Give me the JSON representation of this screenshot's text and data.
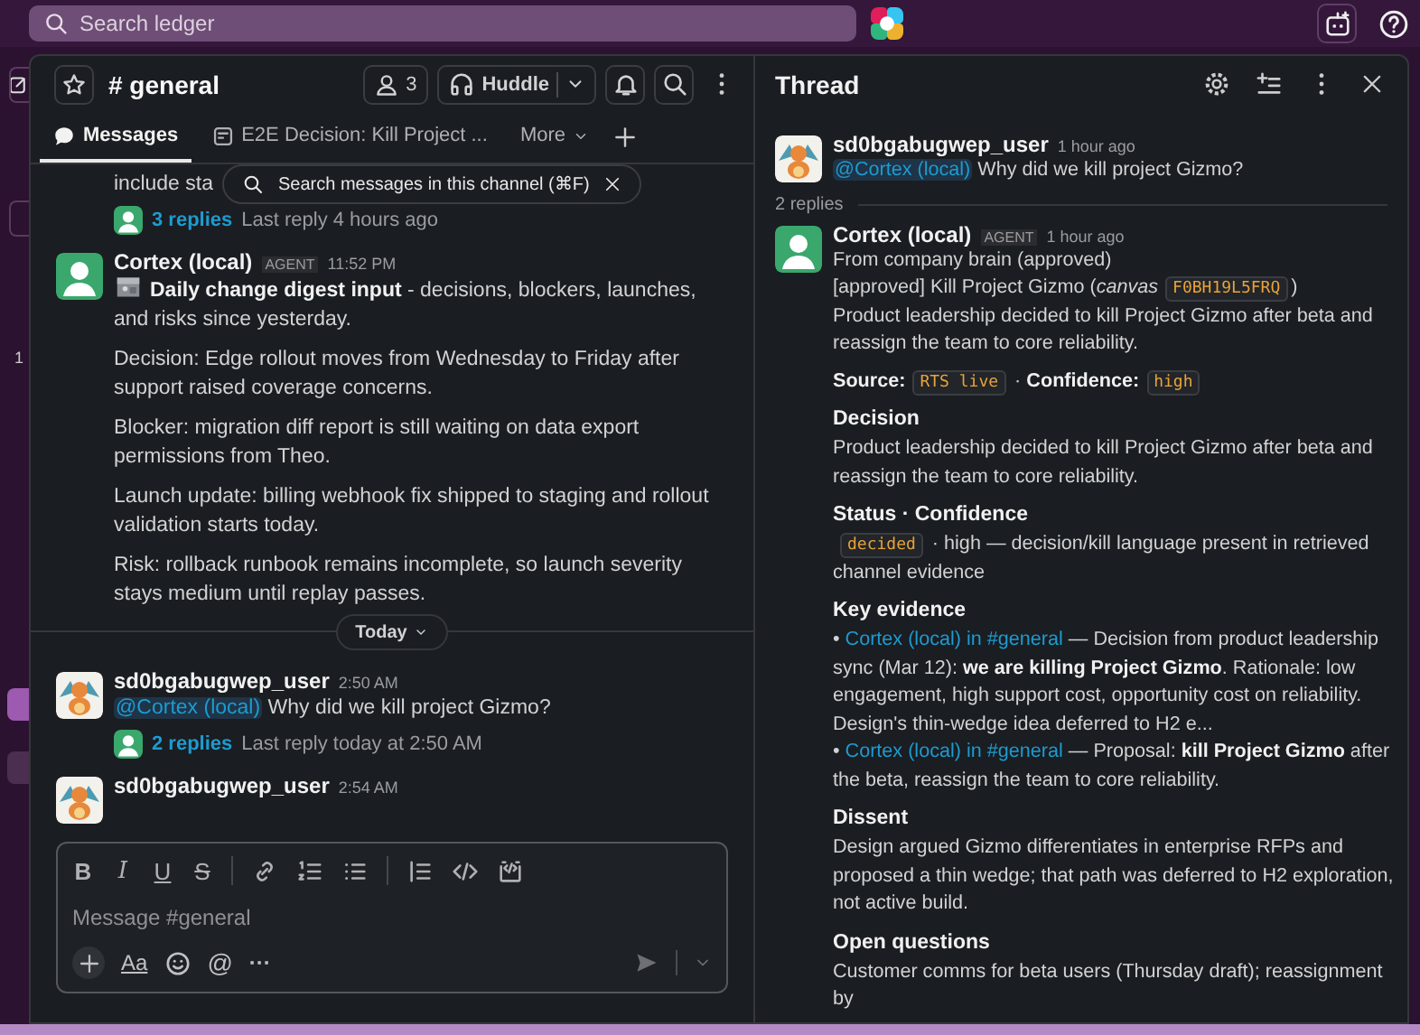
{
  "top_bar": {
    "search": {
      "placeholder": "Search ledger"
    }
  },
  "rail": {
    "badge": "1"
  },
  "channel": {
    "title": "# general",
    "member_count": "3",
    "huddle": "Huddle",
    "tabs": [
      {
        "label": "Messages",
        "selected": true
      },
      {
        "label": "E2E Decision: Kill Project ...",
        "selected": false
      }
    ],
    "more": "More"
  },
  "search_tooltip": "Search messages in this channel (⌘F)",
  "messages": [
    {
      "kind": "fragment",
      "text": "include sta",
      "replies": {
        "count": "3 replies",
        "last": "Last reply 4 hours ago"
      }
    },
    {
      "kind": "message",
      "agent": true,
      "author": "Cortex (local)",
      "badge": "AGENT",
      "time": "11:52 PM",
      "digest_icon": true,
      "paragraphs": [
        "**Daily change digest input** - decisions, blockers, launches, and risks since yesterday.",
        "Decision: Edge rollout moves from Wednesday to Friday after support raised coverage concerns.",
        "Blocker: migration diff report is still waiting on data export permissions from Theo.",
        "Launch update: billing webhook fix shipped to staging and rollout validation starts today.",
        "Risk: rollback runbook remains incomplete, so launch severity stays medium until replay passes."
      ]
    },
    {
      "kind": "divider",
      "label": "Today"
    },
    {
      "kind": "message",
      "agent": false,
      "author": "sd0bgabugwep_user",
      "time": "2:50 AM",
      "mention": "@Cortex (local)",
      "paragraphs": [
        "Why did we kill project Gizmo?"
      ],
      "replies": {
        "count": "2 replies",
        "last": "Last reply today at 2:50 AM"
      }
    },
    {
      "kind": "message",
      "agent": false,
      "author": "sd0bgabugwep_user",
      "time": "2:54 AM"
    }
  ],
  "composer": {
    "format_buttons": [
      "B",
      "I",
      "U",
      "S"
    ],
    "placeholder": "Message #general",
    "text_format": "Aa",
    "mention": "@",
    "more": "···"
  },
  "thread": {
    "title": "Thread",
    "parent": {
      "agent": false,
      "author": "sd0bgabugwep_user",
      "time": "1 hour ago",
      "mention": "@Cortex (local)",
      "text": "Why did we kill project Gizmo?"
    },
    "reply_count": "2 replies",
    "reply": {
      "agent": true,
      "author": "Cortex (local)",
      "badge": "AGENT",
      "time": "1 hour ago",
      "sections": [
        {
          "lines": [
            [
              {
                "kind": "text",
                "text": "From company brain (approved)"
              }
            ],
            [
              {
                "kind": "text",
                "text": "[approved] Kill Project Gizmo ("
              },
              {
                "kind": "italic",
                "text": "canvas"
              },
              {
                "kind": "code",
                "text": "F0BH19L5FRQ"
              },
              {
                "kind": "text",
                "text": ")"
              }
            ],
            [
              {
                "kind": "text",
                "text": "Product leadership decided to kill Project Gizmo after beta and reassign the team to core reliability."
              }
            ]
          ]
        },
        {
          "lines": [
            [
              {
                "kind": "bold",
                "text": "Source:"
              },
              {
                "kind": "code",
                "text": "RTS live"
              },
              {
                "kind": "text",
                "text": " · "
              },
              {
                "kind": "bold",
                "text": "Confidence:"
              },
              {
                "kind": "code",
                "text": "high"
              }
            ]
          ]
        },
        {
          "heading": "Decision",
          "lines": [
            [
              {
                "kind": "text",
                "text": "Product leadership decided to kill Project Gizmo after beta and reassign the team to core reliability."
              }
            ]
          ]
        },
        {
          "heading": "Status · Confidence",
          "lines": [
            [
              {
                "kind": "code",
                "text": "decided"
              },
              {
                "kind": "text",
                "text": " · high — decision/kill language present in retrieved channel evidence"
              }
            ]
          ]
        },
        {
          "heading": "Key evidence",
          "lines": [
            [
              {
                "kind": "text",
                "text": "• "
              },
              {
                "kind": "link",
                "text": "Cortex (local) in #general"
              },
              {
                "kind": "text",
                "text": " — Decision from product leadership sync (Mar 12): "
              },
              {
                "kind": "bold",
                "text": "we are killing Project Gizmo"
              },
              {
                "kind": "text",
                "text": ". Rationale: low engagement, high support cost, opportunity cost on reliability. Design's thin-wedge idea deferred to H2 e..."
              }
            ],
            [
              {
                "kind": "text",
                "text": "• "
              },
              {
                "kind": "link",
                "text": "Cortex (local) in #general"
              },
              {
                "kind": "text",
                "text": " — Proposal: "
              },
              {
                "kind": "bold",
                "text": "kill Project Gizmo"
              },
              {
                "kind": "text",
                "text": " after the beta, reassign the team to core reliability."
              }
            ]
          ]
        },
        {
          "heading": "Dissent",
          "lines": [
            [
              {
                "kind": "text",
                "text": "Design argued Gizmo differentiates in enterprise RFPs and proposed a thin wedge; that path was deferred to H2 exploration, not active build."
              }
            ]
          ]
        },
        {
          "heading": "Open questions",
          "lines": [
            [
              {
                "kind": "text",
                "text": "Customer comms for beta users (Thursday draft); reassignment by"
              }
            ]
          ]
        }
      ]
    }
  }
}
